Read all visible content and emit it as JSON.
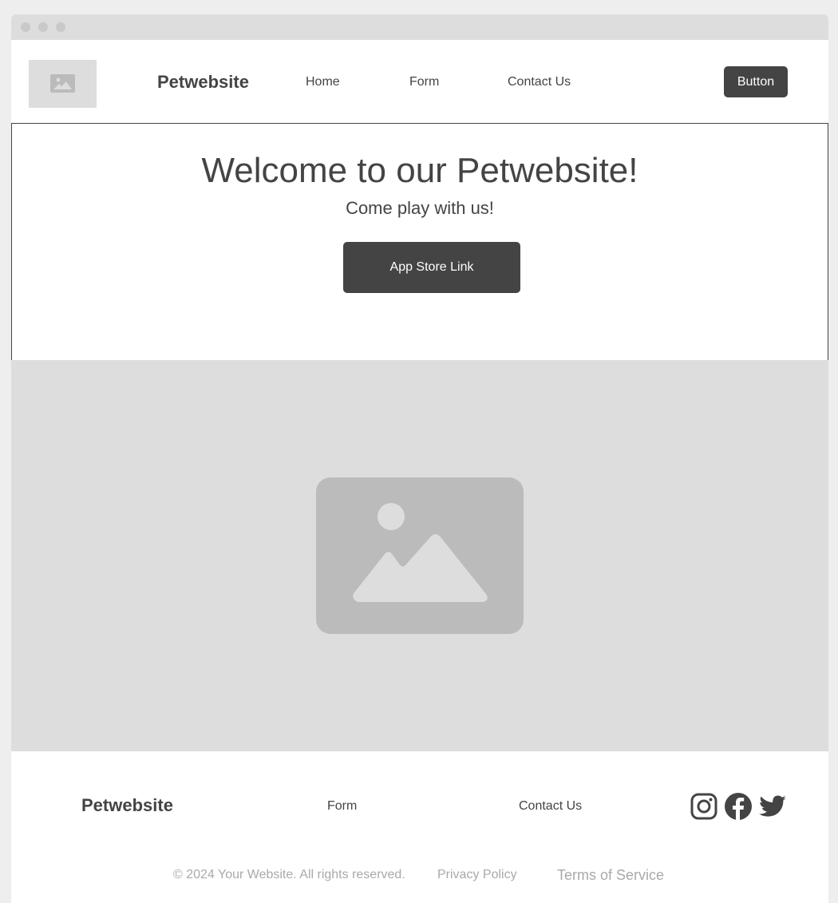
{
  "header": {
    "brand": "Petwebsite",
    "nav": [
      "Home",
      "Form",
      "Contact Us"
    ],
    "button_label": "Button"
  },
  "hero": {
    "title": "Welcome to our Petwebsite!",
    "subtitle": "Come play with us!",
    "cta_label": "App Store Link"
  },
  "footer": {
    "brand": "Petwebsite",
    "links": [
      "Form",
      "Contact Us"
    ],
    "social_icons": [
      "instagram-icon",
      "facebook-icon",
      "twitter-icon"
    ],
    "copyright": "© 2024 Your Website. All rights reserved.",
    "privacy": "Privacy Policy",
    "terms": "Terms of Service"
  },
  "colors": {
    "primary": "#444444",
    "placeholder_bg": "#dddddd",
    "placeholder_icon": "#bbbbbb",
    "muted_text": "#a9a9a9"
  }
}
